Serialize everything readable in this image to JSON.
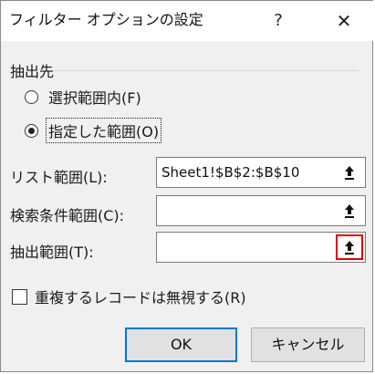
{
  "window": {
    "title": "フィルター オプションの設定",
    "help_glyph": "?",
    "close_glyph": "✕"
  },
  "extract": {
    "section_label": "抽出先",
    "options": [
      {
        "label": "選択範囲内(F)",
        "checked": false
      },
      {
        "label": "指定した範囲(O)",
        "checked": true
      }
    ]
  },
  "fields": [
    {
      "label": "リスト範囲(L):",
      "value": "Sheet1!$B$2:$B$10",
      "button_icon": "collapse-dialog-icon",
      "highlighted": false
    },
    {
      "label": "検索条件範囲(C):",
      "value": "",
      "button_icon": "collapse-dialog-icon",
      "highlighted": false
    },
    {
      "label": "抽出範囲(T):",
      "value": "",
      "button_icon": "collapse-dialog-icon",
      "highlighted": true
    }
  ],
  "unique_checkbox": {
    "label": "重複するレコードは無視する(R)",
    "checked": false
  },
  "buttons": {
    "ok_label": "OK",
    "cancel_label": "キャンセル"
  },
  "colors": {
    "highlight_border": "#e00000",
    "default_button_border": "#0078d7",
    "dialog_background": "#f0f0f0"
  }
}
